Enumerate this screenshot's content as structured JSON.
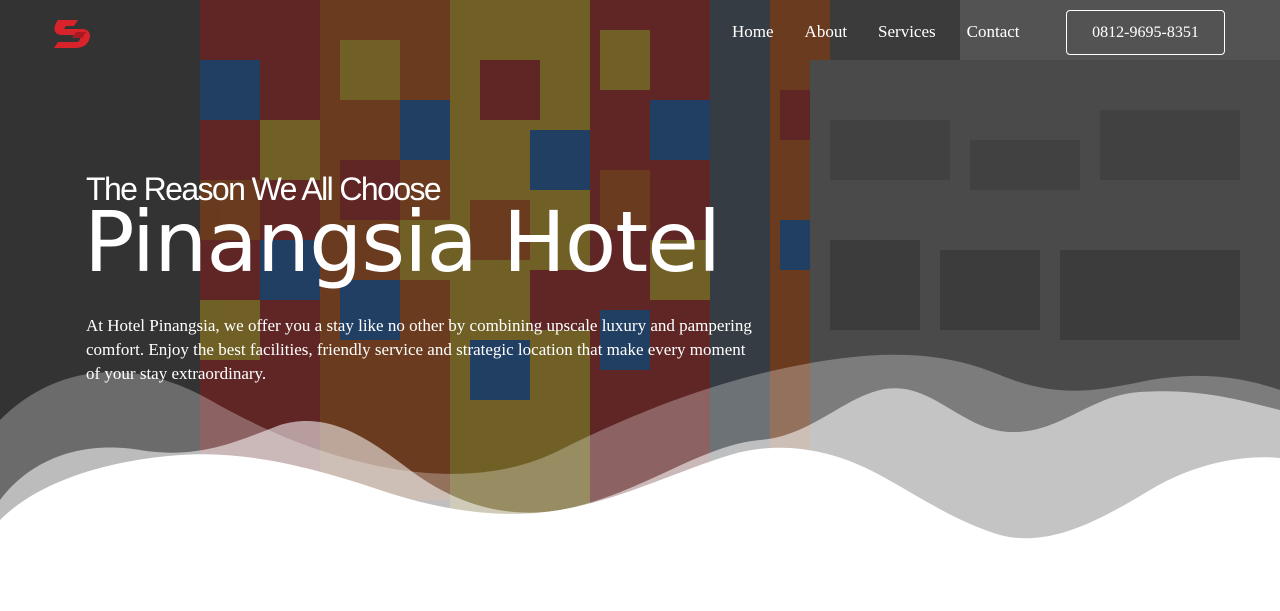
{
  "brand": {
    "logo_icon": "pinangsia-logo-icon",
    "logo_color": "#d8232a"
  },
  "nav": {
    "items": [
      {
        "label": "Home"
      },
      {
        "label": "About"
      },
      {
        "label": "Services"
      },
      {
        "label": "Contact"
      }
    ],
    "phone": "0812-9695-8351"
  },
  "hero": {
    "subtitle": "The Reason We All Choose",
    "title": "Pinangsia Hotel",
    "description": "At Hotel Pinangsia, we offer you a stay like no other by combining upscale luxury and pampering comfort. Enjoy the best facilities, friendly service and strategic location that make every moment of your stay extraordinary."
  },
  "colors": {
    "text": "#ffffff",
    "overlay": "#141414",
    "wave": "#ffffff"
  }
}
